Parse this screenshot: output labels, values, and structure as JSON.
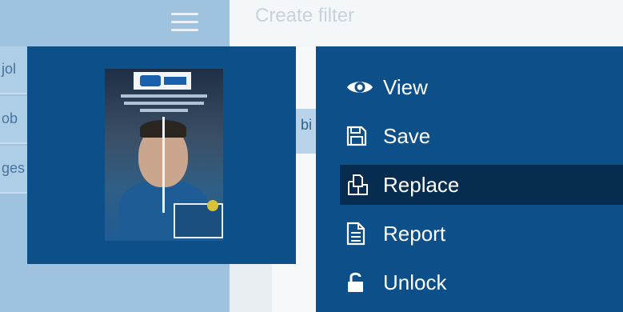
{
  "header": {
    "title": "Create filter"
  },
  "sidebar": {
    "rows": [
      {
        "label": "jol"
      },
      {
        "label": "ob"
      },
      {
        "label": "ges"
      }
    ]
  },
  "content": {
    "chip_label": "bi"
  },
  "menu": {
    "items": [
      {
        "label": "View",
        "icon": "eye-icon"
      },
      {
        "label": "Save",
        "icon": "save-icon"
      },
      {
        "label": "Replace",
        "icon": "replace-icon",
        "active": true
      },
      {
        "label": "Report",
        "icon": "report-icon"
      },
      {
        "label": "Unlock",
        "icon": "unlock-icon"
      }
    ]
  },
  "colors": {
    "menu_bg": "#0d4f88",
    "menu_active": "#062c4f",
    "sidebar_bg": "#9fc3df",
    "menu_text": "#ffffff"
  }
}
